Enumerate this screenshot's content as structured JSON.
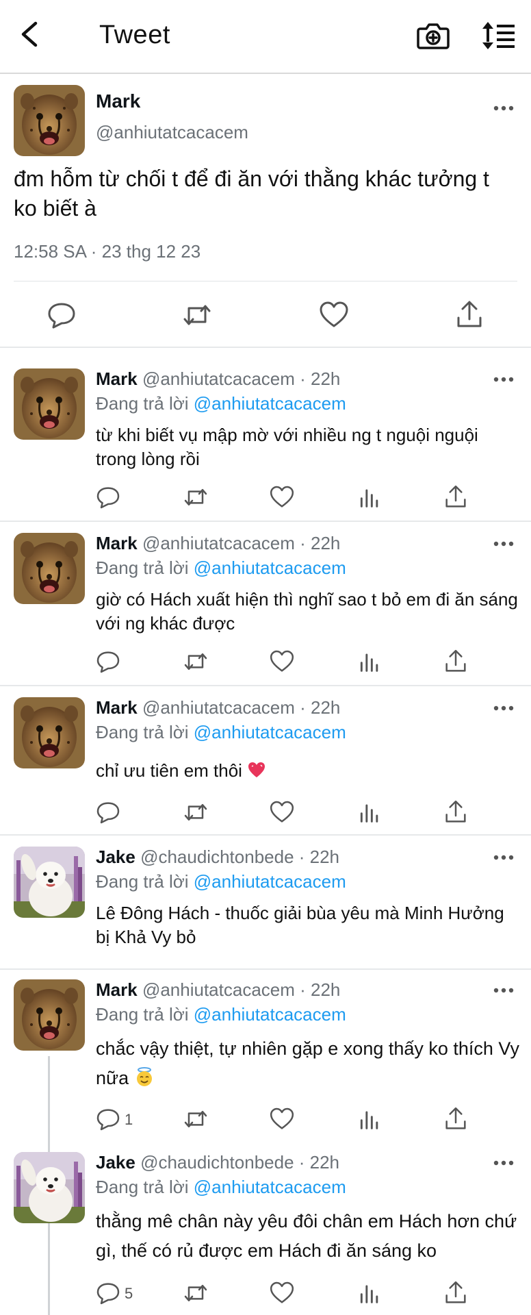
{
  "header": {
    "title": "Tweet",
    "back_icon": "chevron-left-icon",
    "camera_icon": "camera-plus-icon",
    "sort_icon": "sort-list-icon"
  },
  "main_tweet": {
    "author_name": "Mark",
    "handle": "@anhiutatcacacem",
    "text": "đm hỗm từ chối t để đi ăn với thằng khác tưởng t ko biết à",
    "timestamp": "12:58 SA · 23 thg 12 23",
    "actions": [
      "reply-icon",
      "retweet-icon",
      "like-icon",
      "share-icon"
    ]
  },
  "replies": [
    {
      "name": "Mark",
      "handle": "@anhiutatcacacem · 22h",
      "replying_prefix": "Đang trả lời ",
      "replying_to": "@anhiutatcacacem",
      "text": "từ khi biết vụ mập mờ với nhiều ng t nguội nguội trong lòng rồi",
      "reply_count": "",
      "avatar": "cheetah"
    },
    {
      "name": "Mark",
      "handle": "@anhiutatcacacem · 22h",
      "replying_prefix": "Đang trả lời ",
      "replying_to": "@anhiutatcacacem",
      "text": "giờ có Hách xuất hiện thì nghĩ sao t bỏ em đi ăn sáng với ng khác được",
      "reply_count": "",
      "avatar": "cheetah"
    },
    {
      "name": "Mark",
      "handle": "@anhiutatcacacem · 22h",
      "replying_prefix": "Đang trả lời ",
      "replying_to": "@anhiutatcacacem",
      "text": "chỉ ưu tiên em thôi",
      "emoji": "sparkling-heart-emoji",
      "reply_count": "",
      "avatar": "cheetah"
    },
    {
      "name": "Jake",
      "handle": "@chaudichtonbede · 22h",
      "replying_prefix": "Đang trả lời ",
      "replying_to": "@anhiutatcacacem",
      "text": "Lê Đông Hách - thuốc giải bùa yêu mà Minh Hưởng bị Khả Vy bỏ",
      "reply_count": "",
      "avatar": "dog"
    },
    {
      "name": "Mark",
      "handle": "@anhiutatcacacem · 22h",
      "replying_prefix": "Đang trả lời ",
      "replying_to": "@anhiutatcacacem",
      "text": "chắc vậy thiệt, tự nhiên gặp e xong thấy ko thích Vy nữa",
      "emoji": "smiling-face-with-halo-emoji",
      "reply_count": "1",
      "avatar": "cheetah"
    },
    {
      "name": "Jake",
      "handle": "@chaudichtonbede · 22h",
      "replying_prefix": "Đang trả lời ",
      "replying_to": "@anhiutatcacacem",
      "text": "thằng mê chân này yêu đôi chân em Hách hơn chứ gì, thế có rủ được em Hách đi ăn sáng ko",
      "reply_count": "5",
      "avatar": "dog"
    }
  ],
  "colors": {
    "mention": "#1d9bf0",
    "secondary_text": "#6b7177",
    "divider": "#e6e8ea"
  }
}
